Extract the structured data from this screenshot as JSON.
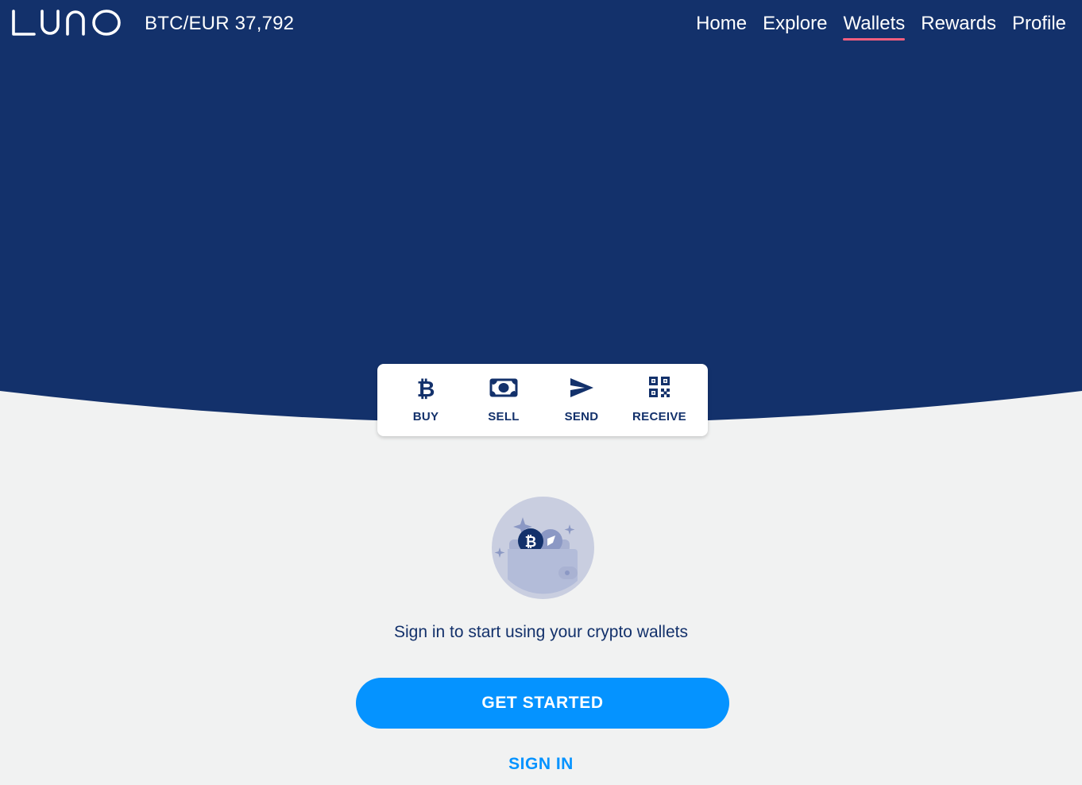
{
  "header": {
    "ticker": "BTC/EUR 37,792",
    "nav": [
      {
        "label": "Home",
        "active": false
      },
      {
        "label": "Explore",
        "active": false
      },
      {
        "label": "Wallets",
        "active": true
      },
      {
        "label": "Rewards",
        "active": false
      },
      {
        "label": "Profile",
        "active": false
      }
    ]
  },
  "actions": [
    {
      "label": "BUY",
      "icon": "bitcoin-icon"
    },
    {
      "label": "SELL",
      "icon": "banknote-icon"
    },
    {
      "label": "SEND",
      "icon": "send-icon"
    },
    {
      "label": "RECEIVE",
      "icon": "qr-code-icon"
    }
  ],
  "main": {
    "prompt": "Sign in to start using your crypto wallets",
    "get_started_label": "GET STARTED",
    "sign_in_label": "SIGN IN",
    "illustration": "wallet-crypto-icon"
  },
  "colors": {
    "brand_navy": "#13316b",
    "page_bg": "#f1f2f2",
    "accent_blue": "#0593ff",
    "active_underline": "#f25f7f"
  }
}
